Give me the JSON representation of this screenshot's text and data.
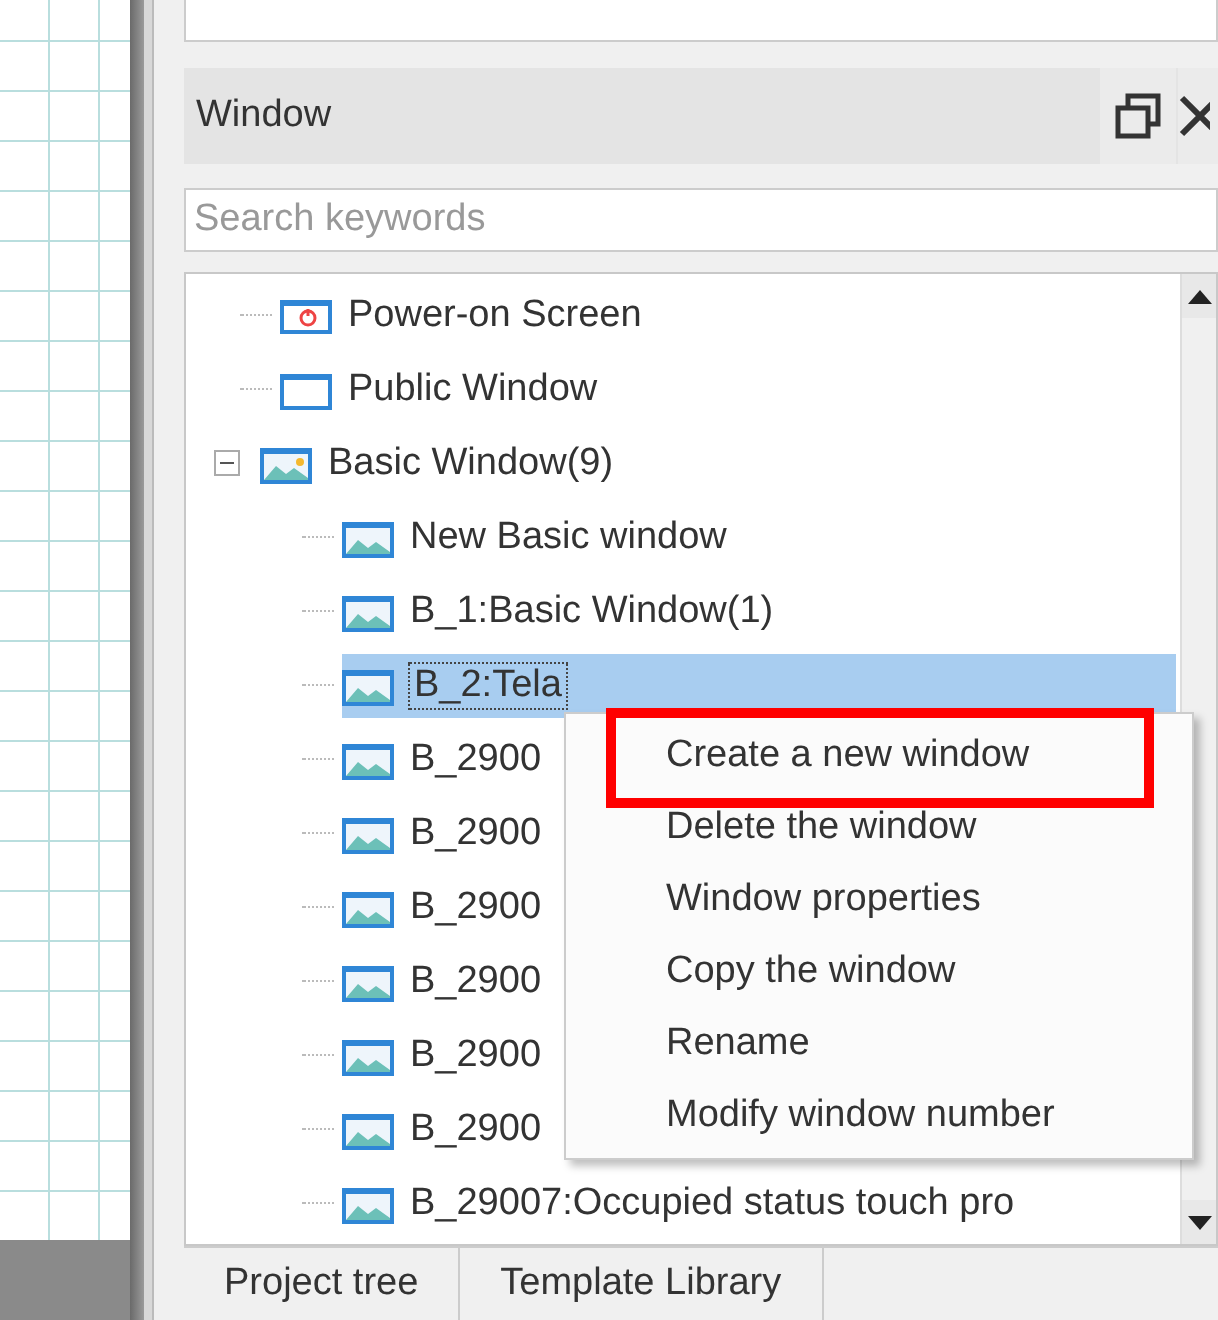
{
  "panel": {
    "title": "Window"
  },
  "search": {
    "placeholder": "Search keywords"
  },
  "tree": {
    "items": [
      {
        "label": "Power-on Screen",
        "kind": "power",
        "selected": false
      },
      {
        "label": "Public Window",
        "kind": "blank",
        "selected": false
      },
      {
        "label": "Basic Window(9)",
        "kind": "picture",
        "selected": false,
        "expanded": true,
        "children": [
          {
            "label": "New Basic window",
            "kind": "landscape",
            "selected": false
          },
          {
            "label": "B_1:Basic Window(1)",
            "kind": "landscape",
            "selected": false
          },
          {
            "label": "B_2:Tela",
            "kind": "landscape",
            "selected": true
          },
          {
            "label": "B_2900",
            "kind": "landscape",
            "selected": false
          },
          {
            "label": "B_2900",
            "kind": "landscape",
            "selected": false
          },
          {
            "label": "B_2900",
            "kind": "landscape",
            "selected": false
          },
          {
            "label": "B_2900",
            "kind": "landscape",
            "selected": false
          },
          {
            "label": "B_2900",
            "kind": "landscape",
            "selected": false
          },
          {
            "label": "B_2900",
            "kind": "landscape",
            "selected": false
          },
          {
            "label": "B_29007:Occupied status touch pro",
            "kind": "landscape",
            "selected": false
          }
        ]
      }
    ]
  },
  "context_menu": {
    "items": [
      {
        "label": "Create a new window",
        "highlighted": true
      },
      {
        "label": "Delete the window",
        "highlighted": false
      },
      {
        "label": "Window properties",
        "highlighted": false
      },
      {
        "label": "Copy the window",
        "highlighted": false
      },
      {
        "label": "Rename",
        "highlighted": false
      },
      {
        "label": "Modify window number",
        "highlighted": false
      }
    ]
  },
  "bottom_tabs": [
    {
      "label": "Project tree"
    },
    {
      "label": "Template Library"
    }
  ]
}
